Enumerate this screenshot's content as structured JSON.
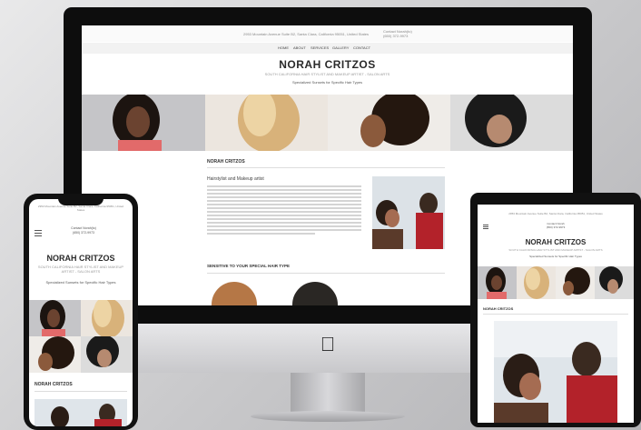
{
  "site": {
    "topbar_address": "2953 Mountain Avenue Suite B2, Santa Clara, California 95051, United States",
    "topbar_contact": "Contact Norah(to)\n(650) 372-9973",
    "nav": [
      "HOME",
      "ABOUT",
      "SERVICES",
      "GALLERY",
      "CONTACT"
    ],
    "title": "NORAH CRITZOS",
    "subtitle": "SOUTH CALIFORNIA HAIR STYLIST AND MAKEUP ARTIST - SALON ARTS",
    "tagline": "Specialized Sunsets for Specific Hair Types",
    "section_heading": "NORAH CRITZOS",
    "para_heading": "Hairstylist and Makeup artist",
    "section2_heading": "SENSITIVE TO YOUR SPECIAL HAIR TYPE"
  },
  "phone": {
    "topbar": "2953 Mountain Avenue Suite B2, Santa Clara, California 95051, United States",
    "contact": "Contact Norah(to)\n(650) 372-9973",
    "title": "NORAH CRITZOS",
    "subtitle": "SOUTH CALIFORNIA HAIR STYLIST AND MAKEUP ARTIST - SALON ARTS",
    "tagline": "Specialized Sunsets for Specific Hair Types",
    "section_heading": "NORAH CRITZOS"
  },
  "tablet": {
    "topbar": "2953 Mountain Avenue Suite B2, Santa Clara, California 95051, United States",
    "contact": "Contact Norah\n(650) 372-9973",
    "title": "NORAH CRITZOS",
    "subtitle": "SOUTH CALIFORNIA HAIR STYLIST AND MAKEUP ARTIST - SALON ARTS",
    "tagline": "Specialized Sunsets for Specific Hair Types",
    "section_heading": "NORAH CRITZOS"
  },
  "icons": {
    "apple": "apple-logo-icon",
    "menu": "hamburger-menu-icon"
  },
  "colors": {
    "accent": "#2a2a2a",
    "background": "#d6d6d8"
  }
}
